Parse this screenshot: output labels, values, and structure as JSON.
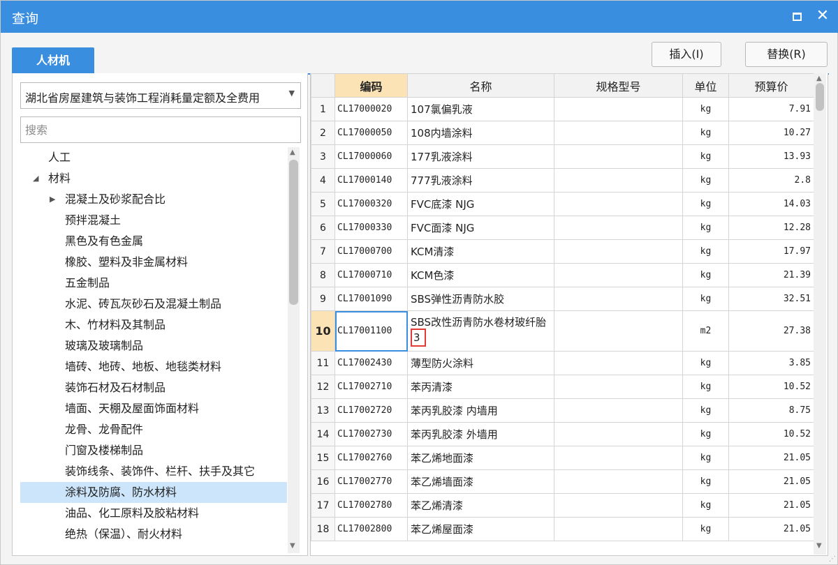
{
  "window": {
    "title": "查询"
  },
  "toolbar": {
    "tab_label": "人材机",
    "insert_label": "插入(I)",
    "replace_label": "替换(R)"
  },
  "left": {
    "quota_library": "湖北省房屋建筑与装饰工程消耗量定额及全费用",
    "search_placeholder": "搜索",
    "tree": [
      {
        "label": "人工",
        "level": 0,
        "expander": ""
      },
      {
        "label": "材料",
        "level": 0,
        "expander": "expanded"
      },
      {
        "label": "混凝土及砂浆配合比",
        "level": 1,
        "expander": "collapsed"
      },
      {
        "label": "预拌混凝土",
        "level": 1,
        "expander": ""
      },
      {
        "label": "黑色及有色金属",
        "level": 1,
        "expander": ""
      },
      {
        "label": "橡胶、塑料及非金属材料",
        "level": 1,
        "expander": ""
      },
      {
        "label": "五金制品",
        "level": 1,
        "expander": ""
      },
      {
        "label": "水泥、砖瓦灰砂石及混凝土制品",
        "level": 1,
        "expander": ""
      },
      {
        "label": "木、竹材料及其制品",
        "level": 1,
        "expander": ""
      },
      {
        "label": "玻璃及玻璃制品",
        "level": 1,
        "expander": ""
      },
      {
        "label": "墙砖、地砖、地板、地毯类材料",
        "level": 1,
        "expander": ""
      },
      {
        "label": "装饰石材及石材制品",
        "level": 1,
        "expander": ""
      },
      {
        "label": "墙面、天棚及屋面饰面材料",
        "level": 1,
        "expander": ""
      },
      {
        "label": "龙骨、龙骨配件",
        "level": 1,
        "expander": ""
      },
      {
        "label": "门窗及楼梯制品",
        "level": 1,
        "expander": ""
      },
      {
        "label": "装饰线条、装饰件、栏杆、扶手及其它",
        "level": 1,
        "expander": ""
      },
      {
        "label": "涂料及防腐、防水材料",
        "level": 1,
        "expander": "",
        "selected": true
      },
      {
        "label": "油品、化工原料及胶粘材料",
        "level": 1,
        "expander": ""
      },
      {
        "label": "绝热（保温）、耐火材料",
        "level": 1,
        "expander": ""
      }
    ]
  },
  "grid": {
    "columns": [
      "编码",
      "名称",
      "规格型号",
      "单位",
      "预算价"
    ],
    "current_row": "10",
    "rows": [
      {
        "no": "1",
        "code": "CL17000020",
        "name": "107氯偏乳液",
        "spec": "",
        "unit": "kg",
        "price": "7.91"
      },
      {
        "no": "2",
        "code": "CL17000050",
        "name": "108内墙涂料",
        "spec": "",
        "unit": "kg",
        "price": "10.27"
      },
      {
        "no": "3",
        "code": "CL17000060",
        "name": "177乳液涂料",
        "spec": "",
        "unit": "kg",
        "price": "13.93"
      },
      {
        "no": "4",
        "code": "CL17000140",
        "name": "777乳液涂料",
        "spec": "",
        "unit": "kg",
        "price": "2.8"
      },
      {
        "no": "5",
        "code": "CL17000320",
        "name": "FVC底漆 NJG",
        "spec": "",
        "unit": "kg",
        "price": "14.03"
      },
      {
        "no": "6",
        "code": "CL17000330",
        "name": "FVC面漆 NJG",
        "spec": "",
        "unit": "kg",
        "price": "12.28"
      },
      {
        "no": "7",
        "code": "CL17000700",
        "name": "KCM清漆",
        "spec": "",
        "unit": "kg",
        "price": "17.97"
      },
      {
        "no": "8",
        "code": "CL17000710",
        "name": "KCM色漆",
        "spec": "",
        "unit": "kg",
        "price": "21.39"
      },
      {
        "no": "9",
        "code": "CL17001090",
        "name": "SBS弹性沥青防水胶",
        "spec": "",
        "unit": "kg",
        "price": "32.51"
      },
      {
        "no": "10",
        "code": "CL17001100",
        "name": "SBS改性沥青防水卷材玻纤胎",
        "name_suffix": "3",
        "spec": "",
        "unit": "m2",
        "price": "27.38"
      },
      {
        "no": "11",
        "code": "CL17002430",
        "name": "薄型防火涂料",
        "spec": "",
        "unit": "kg",
        "price": "3.85"
      },
      {
        "no": "12",
        "code": "CL17002710",
        "name": "苯丙清漆",
        "spec": "",
        "unit": "kg",
        "price": "10.52"
      },
      {
        "no": "13",
        "code": "CL17002720",
        "name": "苯丙乳胶漆 内墙用",
        "spec": "",
        "unit": "kg",
        "price": "8.75"
      },
      {
        "no": "14",
        "code": "CL17002730",
        "name": "苯丙乳胶漆 外墙用",
        "spec": "",
        "unit": "kg",
        "price": "10.52"
      },
      {
        "no": "15",
        "code": "CL17002760",
        "name": "苯乙烯地面漆",
        "spec": "",
        "unit": "kg",
        "price": "21.05"
      },
      {
        "no": "16",
        "code": "CL17002770",
        "name": "苯乙烯墙面漆",
        "spec": "",
        "unit": "kg",
        "price": "21.05"
      },
      {
        "no": "17",
        "code": "CL17002780",
        "name": "苯乙烯清漆",
        "spec": "",
        "unit": "kg",
        "price": "21.05"
      },
      {
        "no": "18",
        "code": "CL17002800",
        "name": "苯乙烯屋面漆",
        "spec": "",
        "unit": "kg",
        "price": "21.05"
      }
    ]
  },
  "icons": {
    "maximize": "maximize-icon",
    "close": "close-icon",
    "dropdown": "chevron-down-icon"
  },
  "colors": {
    "accent": "#3a8ee0",
    "selected_tree_row": "#cce5fb",
    "code_header": "#fbe3b6",
    "edit_highlight": "#e53935"
  }
}
